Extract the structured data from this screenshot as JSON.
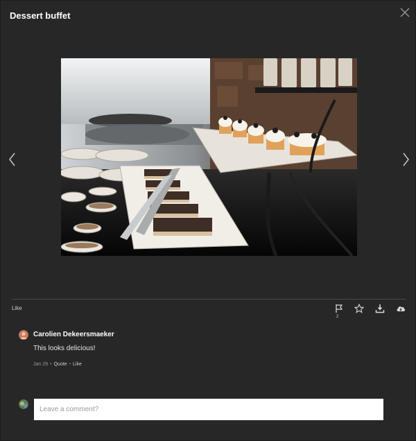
{
  "window": {
    "title": "Dessert buffet"
  },
  "icons": {
    "close": "close-icon",
    "prev": "chevron-left-icon",
    "next": "chevron-right-icon",
    "flag": "flag-icon",
    "star": "star-icon",
    "download": "download-icon",
    "cloud": "cloud-download-icon"
  },
  "actions": {
    "like_label": "Like",
    "flag_count": "2"
  },
  "comment": {
    "author": "Carolien Dekeersmaeker",
    "text": "This looks delicious!",
    "date": "Jan 29",
    "quote_label": "Quote",
    "like_label": "Like"
  },
  "new_comment": {
    "placeholder": "Leave a comment?"
  },
  "colors": {
    "background": "#272727",
    "divider": "#4a4a4a"
  }
}
